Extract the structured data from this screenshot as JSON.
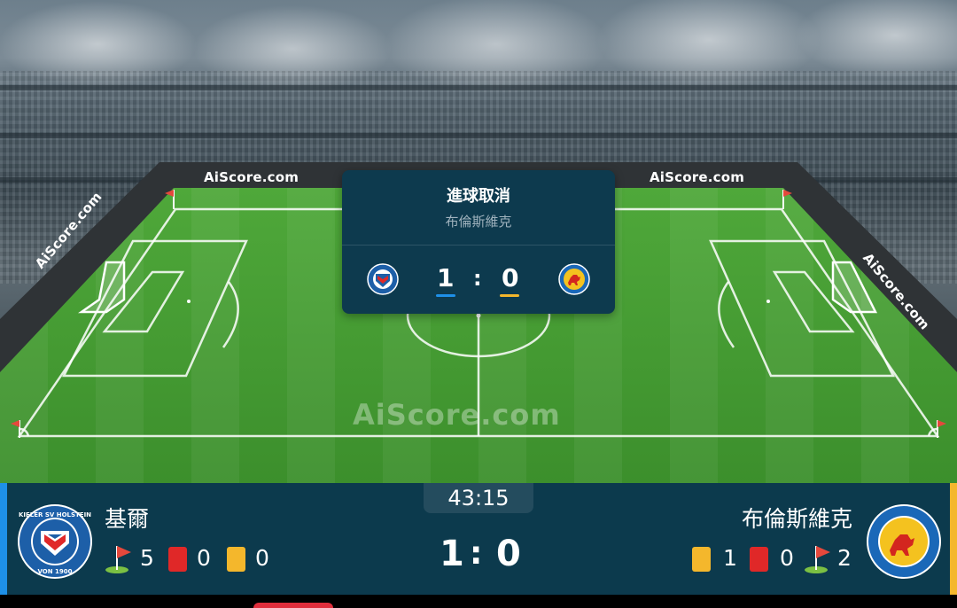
{
  "watermark": {
    "center": "AiScore.com",
    "board_left_top": "AiScore.com",
    "board_right_top": "AiScore.com",
    "board_left_side": "AiScore.com",
    "board_right_side": "AiScore.com"
  },
  "event_popup": {
    "title": "進球取消",
    "team": "布倫斯維克",
    "home_score": "1",
    "separator": ":",
    "away_score": "0",
    "home_color": "#1e90e8",
    "away_color": "#f4b72c"
  },
  "match": {
    "clock": "43:15",
    "home": {
      "name": "基爾",
      "logo_icon": "holstein-kiel-crest",
      "logo_text_top": "KIELER SV HOLSTEIN",
      "logo_text_bottom": "VON 1900",
      "corners": "5",
      "red_cards": "0",
      "yellow_cards": "0",
      "accent": "#1e90e8"
    },
    "away": {
      "name": "布倫斯維克",
      "logo_icon": "eintracht-braunschweig-crest",
      "logo_text": "BRAUNSCHWEIGER TURN- U. SPORTVEREIN EINTRACHT E.V. 1895",
      "yellow_cards": "1",
      "red_cards": "0",
      "corners": "2",
      "accent": "#f4b72c"
    },
    "score": {
      "home": "1",
      "separator": ":",
      "away": "0"
    }
  }
}
